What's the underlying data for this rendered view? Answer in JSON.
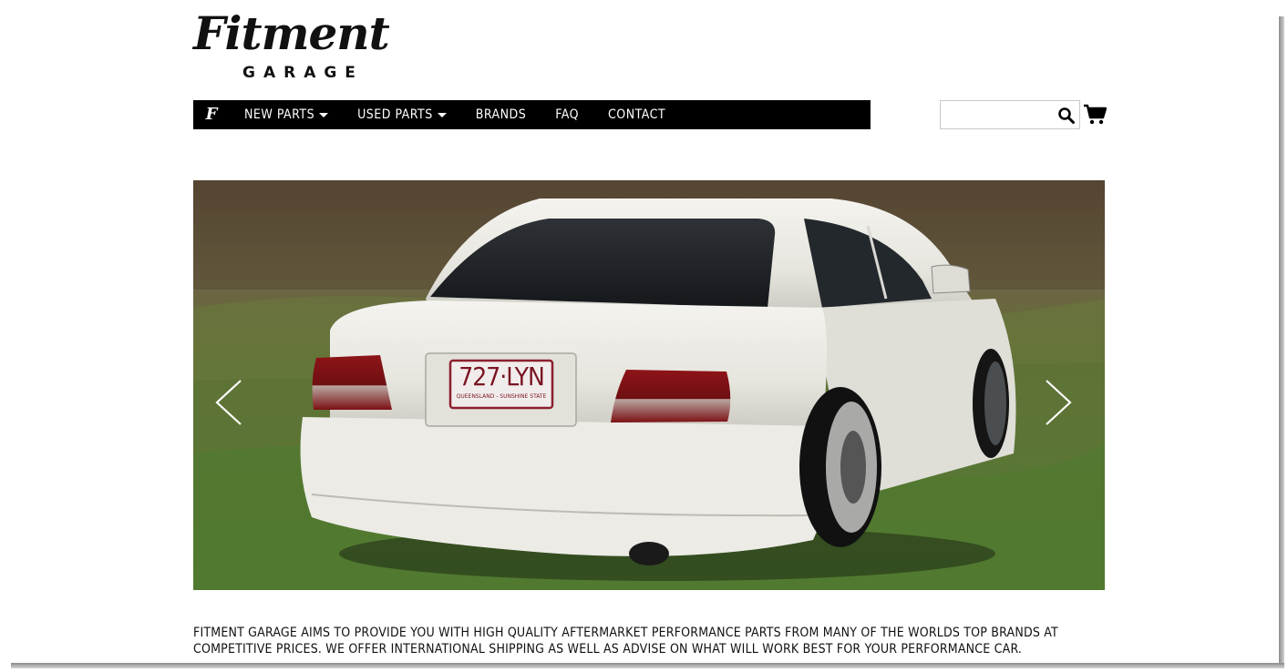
{
  "brand": {
    "logo_script": "Fitment",
    "logo_sub": "GARAGE",
    "home_glyph": "F"
  },
  "nav": {
    "items": [
      {
        "label": "NEW PARTS",
        "dropdown": true
      },
      {
        "label": "USED PARTS",
        "dropdown": true
      },
      {
        "label": "BRANDS",
        "dropdown": false
      },
      {
        "label": "FAQ",
        "dropdown": false
      },
      {
        "label": "CONTACT",
        "dropdown": false
      }
    ]
  },
  "search": {
    "value": "",
    "placeholder": "",
    "icon": "search-icon"
  },
  "cart": {
    "icon": "cart-icon"
  },
  "hero": {
    "image_alt": "",
    "plate_text": "727·LYN",
    "plate_sub": "QUEENSLAND - SUNSHINE STATE",
    "prev_icon": "chevron-left-icon",
    "next_icon": "chevron-right-icon"
  },
  "tagline": "FITMENT GARAGE AIMS TO PROVIDE YOU WITH HIGH QUALITY AFTERMARKET PERFORMANCE PARTS FROM MANY OF THE WORLDS TOP BRANDS AT COMPETITIVE PRICES. WE OFFER INTERNATIONAL SHIPPING AS WELL AS ADVISE ON WHAT WILL WORK BEST FOR YOUR PERFORMANCE CAR.",
  "colors": {
    "nav_bg": "#000000",
    "nav_text": "#ffffff",
    "text": "#111111",
    "grass": "#5f7a3a",
    "car": "#ecebe6"
  }
}
